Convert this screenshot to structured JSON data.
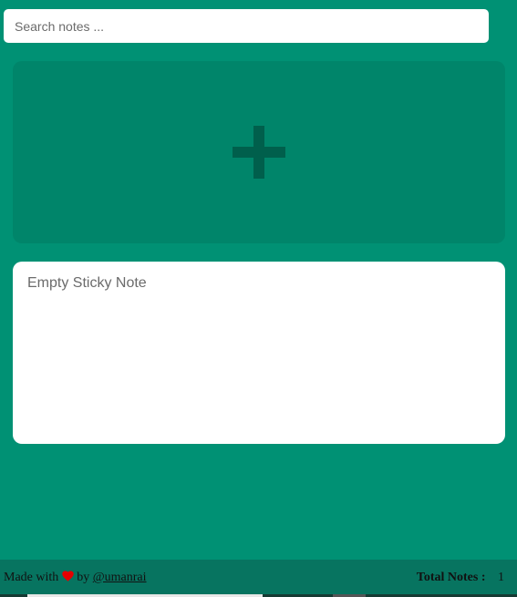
{
  "search": {
    "placeholder": "Search notes ..."
  },
  "add_note": {
    "icon": "plus-icon"
  },
  "notes": [
    {
      "placeholder": "Empty Sticky Note",
      "value": ""
    }
  ],
  "footer": {
    "made_with": "Made with",
    "heart_icon": "heart-icon",
    "by": "by",
    "author": "@umanrai",
    "total_label": "Total Notes :",
    "total_value": "1"
  },
  "colors": {
    "background": "#009174",
    "add_card": "#00856a",
    "plus": "#005f4c",
    "footer": "#077460",
    "heart": "#e60000"
  }
}
